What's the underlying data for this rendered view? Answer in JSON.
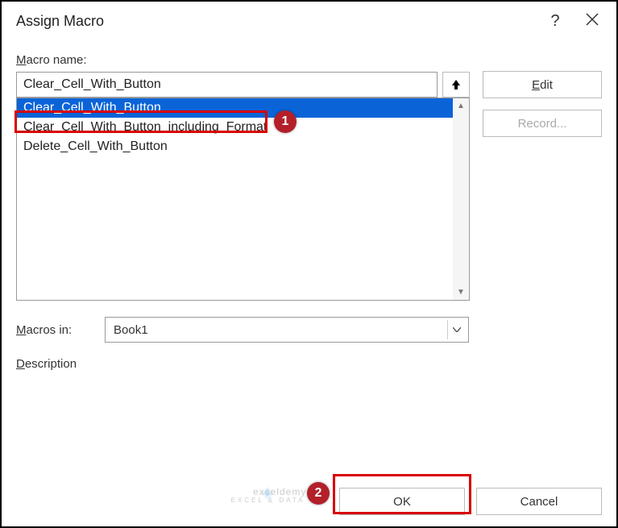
{
  "dialog": {
    "title": "Assign Macro"
  },
  "labels": {
    "macroName": "acro name:",
    "macroNamePrefix": "M",
    "macrosIn": "acros in:",
    "macrosInPrefix": "M",
    "description": "escription",
    "descriptionPrefix": "D"
  },
  "input": {
    "macroNameValue": "Clear_Cell_With_Button"
  },
  "list": {
    "items": [
      {
        "label": "Clear_Cell_With_Button",
        "selected": true
      },
      {
        "label": "Clear_Cell_With_Button_including_Format",
        "selected": false
      },
      {
        "label": "Delete_Cell_With_Button",
        "selected": false
      }
    ]
  },
  "sideButtons": {
    "edit": "dit",
    "editPrefix": "E",
    "record": "Record..."
  },
  "macrosInSelect": {
    "value": "Book1"
  },
  "footer": {
    "ok": "OK",
    "cancel": "Cancel"
  },
  "annotations": {
    "n1": "1",
    "n2": "2"
  },
  "watermark": {
    "main": "exceldemy",
    "sub": "EXCEL & DATA · BI"
  }
}
